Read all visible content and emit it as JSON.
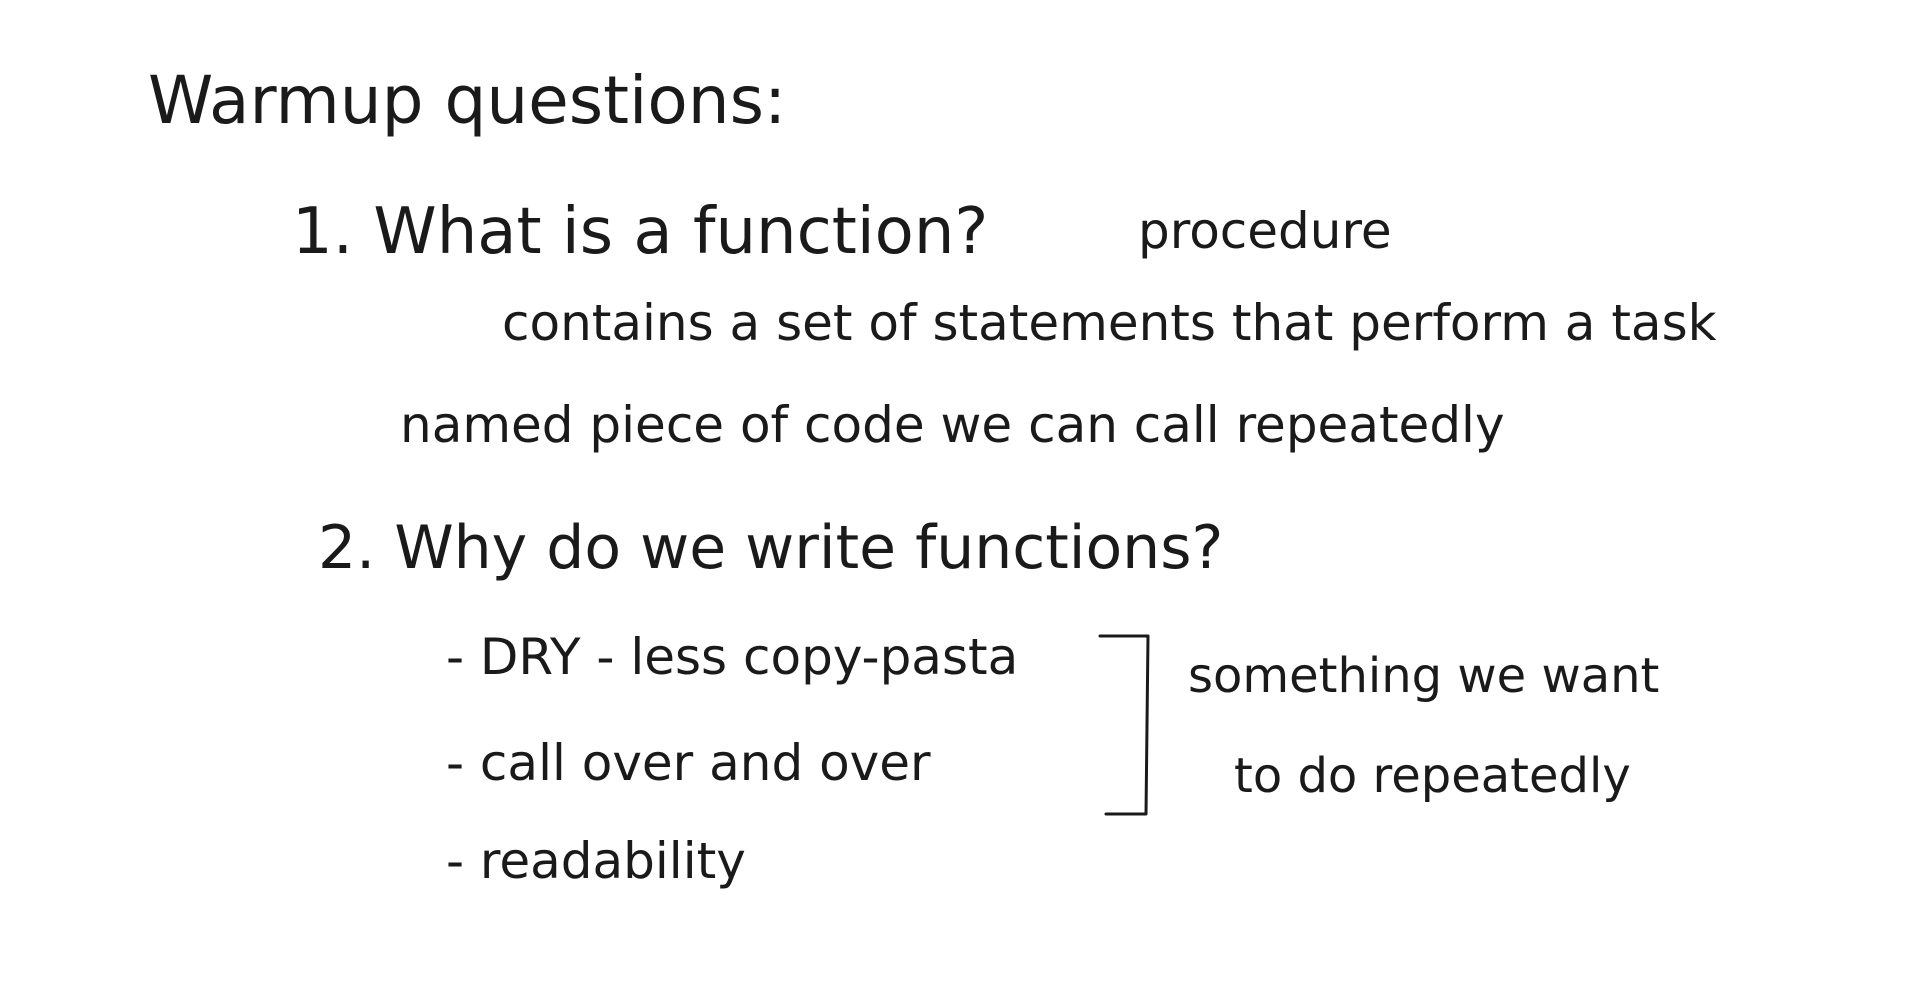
{
  "notes": {
    "title": "Warmup questions:",
    "q1": {
      "question": "1. What is a function?",
      "aside": "procedure",
      "answer_1": "contains a set of statements that perform a task",
      "answer_2": "named piece of code  we can call repeatedly"
    },
    "q2": {
      "question": "2. Why do we write functions?",
      "bullets": [
        "- DRY -  less copy-pasta",
        "- call over and over",
        "- readability"
      ],
      "bracket_note": [
        "something we want",
        "to do repeatedly"
      ]
    }
  }
}
